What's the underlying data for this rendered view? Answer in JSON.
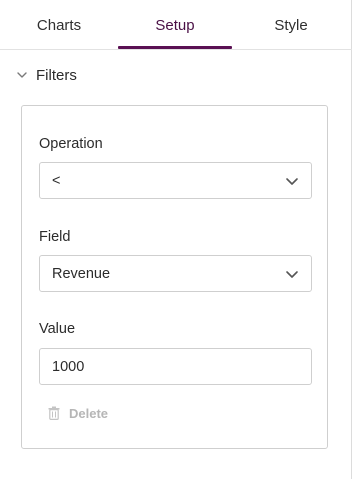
{
  "tabs": [
    {
      "label": "Charts"
    },
    {
      "label": "Setup"
    },
    {
      "label": "Style"
    }
  ],
  "active_tab": "Setup",
  "section": {
    "title": "Filters"
  },
  "filter": {
    "operation": {
      "label": "Operation",
      "value": "<"
    },
    "field": {
      "label": "Field",
      "value": "Revenue"
    },
    "value": {
      "label": "Value",
      "value": "1000"
    },
    "delete_label": "Delete"
  },
  "colors": {
    "accent": "#5a1053",
    "border": "#cfcfcf",
    "muted": "#b6b6b6"
  }
}
